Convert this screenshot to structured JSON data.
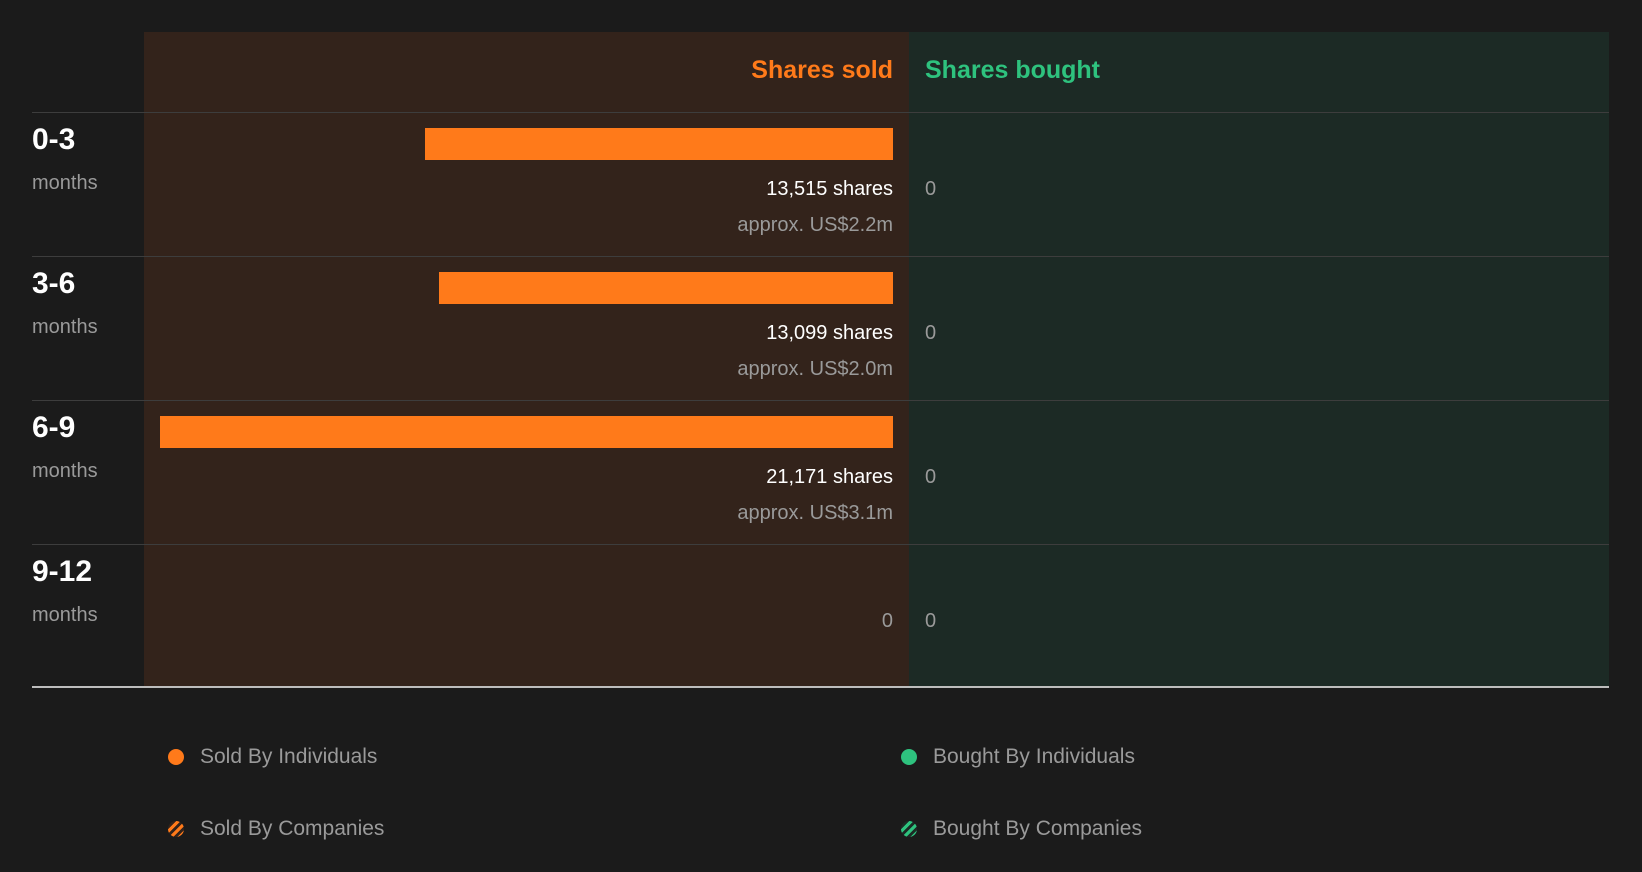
{
  "chart_data": {
    "type": "bar",
    "orientation": "diverging-horizontal",
    "column_headers": {
      "sold": "Shares sold",
      "bought": "Shares bought"
    },
    "rows": [
      {
        "period": "0-3",
        "unit": "months",
        "sold_shares": 13515,
        "sold_label": "13,515 shares",
        "sold_value": "approx. US$2.2m",
        "bought_label": "0"
      },
      {
        "period": "3-6",
        "unit": "months",
        "sold_shares": 13099,
        "sold_label": "13,099 shares",
        "sold_value": "approx. US$2.0m",
        "bought_label": "0"
      },
      {
        "period": "6-9",
        "unit": "months",
        "sold_shares": 21171,
        "sold_label": "21,171 shares",
        "sold_value": "approx. US$3.1m",
        "bought_label": "0"
      },
      {
        "period": "9-12",
        "unit": "months",
        "sold_shares": 0,
        "sold_label": "0",
        "sold_value": "",
        "bought_label": "0"
      }
    ],
    "legend": [
      {
        "label": "Sold By Individuals",
        "color": "#ff7a1a",
        "style": "solid"
      },
      {
        "label": "Bought By Individuals",
        "color": "#2ec27e",
        "style": "solid"
      },
      {
        "label": "Sold By Companies",
        "color": "#ff7a1a",
        "style": "striped"
      },
      {
        "label": "Bought By Companies",
        "color": "#2ec27e",
        "style": "striped"
      }
    ],
    "colors": {
      "sold": "#ff7a1a",
      "bought": "#2ec27e"
    }
  }
}
